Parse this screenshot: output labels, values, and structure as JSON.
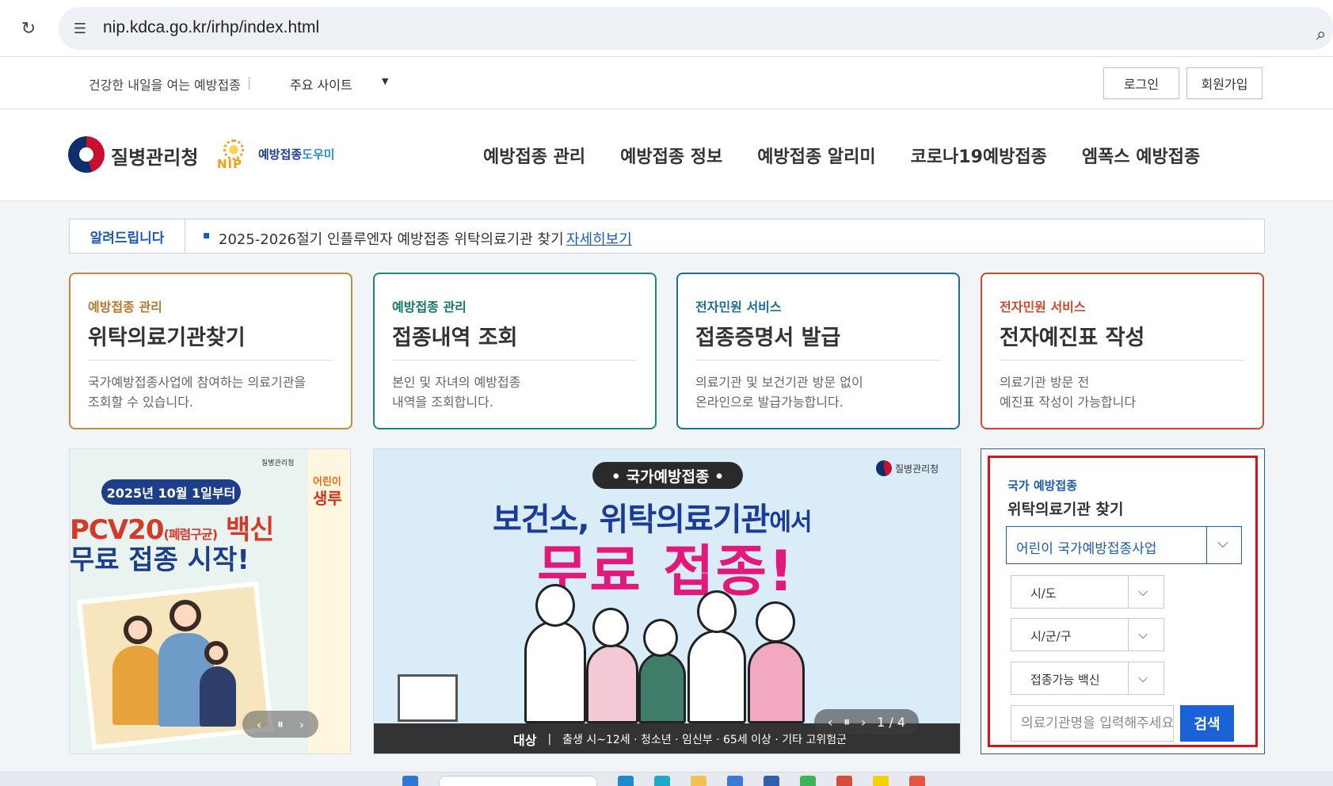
{
  "browser": {
    "url": "nip.kdca.go.kr/irhp/index.html"
  },
  "utility": {
    "tagline": "건강한 내일을 여는 예방접종",
    "separator": "|",
    "sites_label": "주요 사이트",
    "dropdown_arrow": "▼",
    "login": "로그인",
    "join": "회원가입"
  },
  "header": {
    "kdca_name": "질병관리청",
    "nip_text": "NIP",
    "nip_name_a": "예방접종",
    "nip_name_b": "도우미",
    "nav": [
      "예방접종 관리",
      "예방접종 정보",
      "예방접종 알리미",
      "코로나19예방접종",
      "엠폭스 예방접종"
    ]
  },
  "notice": {
    "tag": "알려드립니다",
    "bullet": "▪",
    "text": "2025-2026절기 인플루엔자 예방접종 위탁의료기관 찾기",
    "more": "자세히보기"
  },
  "cards": [
    {
      "category": "예방접종 관리",
      "title": "위탁의료기관찾기",
      "desc_1": "국가예방접종사업에 참여하는 의료기관을",
      "desc_2": "조회할 수 있습니다.",
      "color": "#c48a3a"
    },
    {
      "category": "예방접종 관리",
      "title": "접종내역 조회",
      "desc_1": "본인 및 자녀의 예방접종",
      "desc_2": "내역을 조회합니다.",
      "color": "#1b8a7a"
    },
    {
      "category": "전자민원 서비스",
      "title": "접종증명서 발급",
      "desc_1": "의료기관 및 보건기관 방문 없이",
      "desc_2": "온라인으로 발급가능합니다.",
      "color": "#1b6f98"
    },
    {
      "category": "전자민원 서비스",
      "title": "전자예진표 작성",
      "desc_1": "의료기관 방문 전",
      "desc_2": "예진표 작성이 가능합니다",
      "color": "#d0492e"
    }
  ],
  "banner_left": {
    "kdca": "질병관리청",
    "date_pill": "2025년 10월 1일부터",
    "headline_1": "PCV20",
    "headline_1_small": "(폐렴구균)",
    "headline_1_tail": " 백신",
    "headline_2": "무료 접종 시작!",
    "back_text_1": "어린이",
    "back_text_2": "생루",
    "controls": {
      "prev": "‹",
      "pause": "⏸",
      "next": "›"
    }
  },
  "banner_center": {
    "kdca": "질병관리청",
    "pill": "• 국가예방접종 •",
    "headline_1": "보건소, 위탁의료기관",
    "headline_1_tail": "에서",
    "headline_2": "무료 접종!",
    "target_label": "대상",
    "target_sep": "|",
    "target_text": "출생 시~12세 · 청소년 · 임신부 · 65세 이상 · 기타 고위험군",
    "controls": {
      "prev": "‹",
      "pause": "⏸",
      "next": "›",
      "page": "1 / 4"
    }
  },
  "search": {
    "category": "국가 예방접종",
    "title": "위탁의료기관 찾기",
    "program_select": "어린이 국가예방접종사업",
    "sido": "시/도",
    "sigungu": "시/군/구",
    "vaccine": "접종가능 백신",
    "chevron": "⌵",
    "input_placeholder": "의료기관명을 입력해주세요",
    "button": "검색"
  }
}
